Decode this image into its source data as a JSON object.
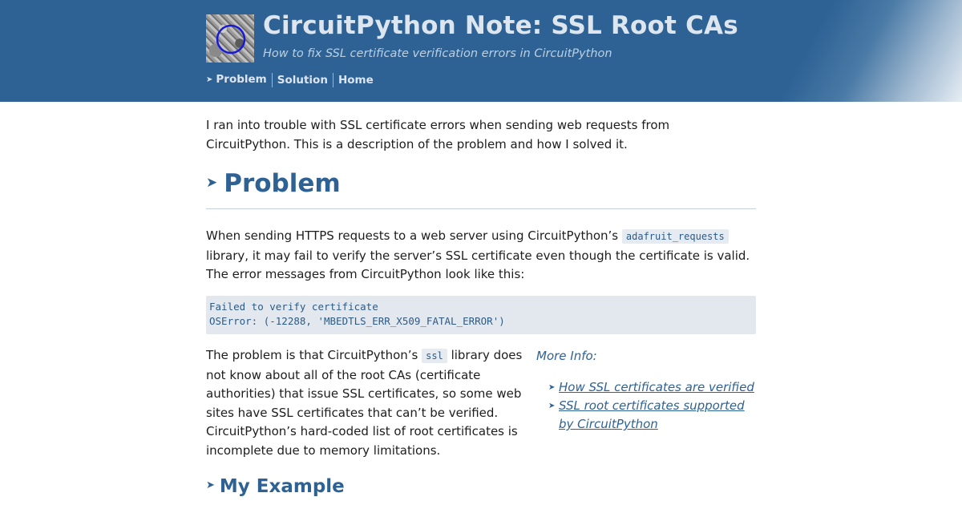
{
  "header": {
    "title": "CircuitPython Note: SSL Root CAs",
    "subtitle": "How to fix SSL certificate verification errors in CircuitPython",
    "nav": [
      {
        "label": "Problem",
        "active": true
      },
      {
        "label": "Solution",
        "active": false
      },
      {
        "label": "Home",
        "active": false
      }
    ],
    "nav_arrow": "➤"
  },
  "intro": "I ran into trouble with SSL certificate errors when sending web requests from CircuitPython. This is a description of the problem and how I solved it.",
  "problem_section": {
    "heading": "Problem",
    "arrow": "➤",
    "para1_before": "When sending HTTPS requests to a web server using CircuitPython’s ",
    "para1_code": "adafruit_requests",
    "para1_after": " library, it may fail to verify the server’s SSL certificate even though the certificate is valid. The error messages from CircuitPython look like this:",
    "code_block": "Failed to verify certificate\nOSError: (-12288, 'MBEDTLS_ERR_X509_FATAL_ERROR')",
    "para2_before": "The problem is that CircuitPython’s ",
    "para2_code": "ssl",
    "para2_after": " library does not know about all of the root CAs (certificate authorities) that issue SSL certificates, so some web sites have SSL certificates that can’t be verified. CircuitPython’s hard-coded list of root certificates is incomplete due to memory limitations."
  },
  "more_info": {
    "title": "More Info:",
    "links": [
      "How SSL certificates are verified",
      "SSL root certificates supported by CircuitPython"
    ]
  },
  "example_section": {
    "heading": "My Example",
    "arrow": "➤"
  },
  "colors": {
    "header_bg": "#2e6295",
    "accent": "#2e6295",
    "code_bg": "#e3e8ee"
  },
  "icons": {
    "avatar": "avatar-photo",
    "bullet": "arrow-right-icon"
  }
}
